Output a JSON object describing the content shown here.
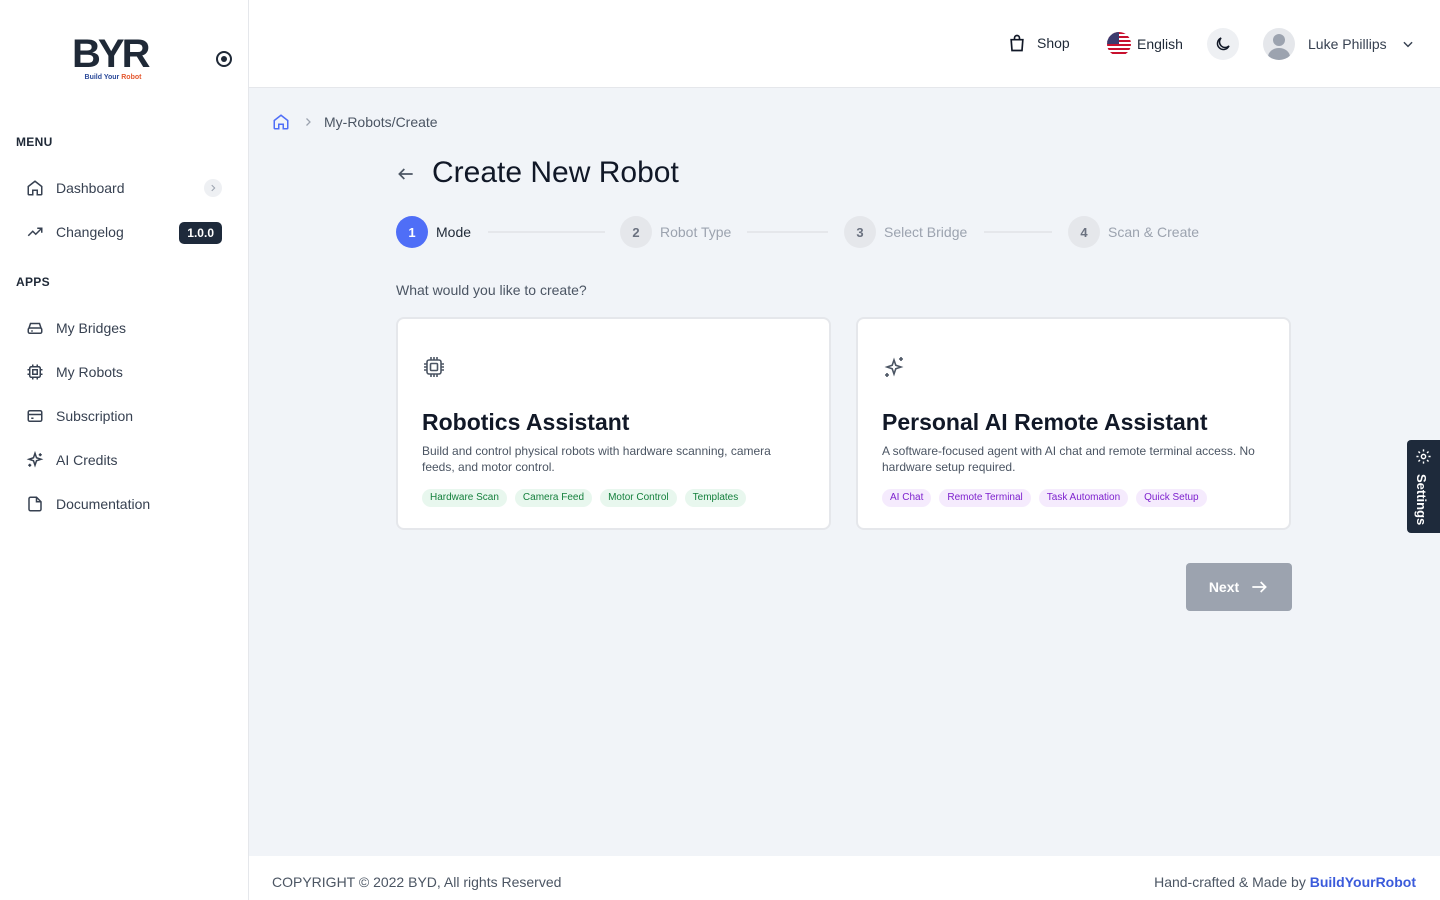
{
  "brand": {
    "logo_letters": "BYR",
    "logo_tagline_a": "Build Your",
    "logo_tagline_b": "Robot"
  },
  "sidebar": {
    "menu_label": "MENU",
    "apps_label": "APPS",
    "menu_items": [
      {
        "label": "Dashboard",
        "icon": "home-icon"
      },
      {
        "label": "Changelog",
        "icon": "trending-icon",
        "badge": "1.0.0"
      }
    ],
    "app_items": [
      {
        "label": "My Bridges",
        "icon": "server-icon"
      },
      {
        "label": "My Robots",
        "icon": "chip-icon"
      },
      {
        "label": "Subscription",
        "icon": "credit-card-icon"
      },
      {
        "label": "AI Credits",
        "icon": "sparkles-icon"
      },
      {
        "label": "Documentation",
        "icon": "file-icon"
      }
    ]
  },
  "header": {
    "shop_label": "Shop",
    "language_label": "English",
    "user_name": "Luke Phillips"
  },
  "breadcrumb": {
    "path": "My-Robots/Create"
  },
  "page": {
    "title": "Create New Robot",
    "prompt": "What would you like to create?"
  },
  "stepper": {
    "steps": [
      {
        "number": "1",
        "label": "Mode",
        "active": true
      },
      {
        "number": "2",
        "label": "Robot Type",
        "active": false
      },
      {
        "number": "3",
        "label": "Select Bridge",
        "active": false
      },
      {
        "number": "4",
        "label": "Scan & Create",
        "active": false
      }
    ]
  },
  "cards": [
    {
      "title": "Robotics Assistant",
      "description": "Build and control physical robots with hardware scanning, camera feeds, and motor control.",
      "icon": "chip-icon",
      "tags": [
        "Hardware Scan",
        "Camera Feed",
        "Motor Control",
        "Templates"
      ]
    },
    {
      "title": "Personal AI Remote Assistant",
      "description": "A software-focused agent with AI chat and remote terminal access. No hardware setup required.",
      "icon": "sparkles-icon",
      "tags": [
        "AI Chat",
        "Remote Terminal",
        "Task Automation",
        "Quick Setup"
      ]
    }
  ],
  "actions": {
    "next_label": "Next"
  },
  "settings_tab": {
    "label": "Settings"
  },
  "footer": {
    "copyright": "COPYRIGHT © 2022 BYD, All rights Reserved",
    "made_by_prefix": "Hand-crafted & Made by",
    "made_by_brand": "BuildYourRobot"
  },
  "colors": {
    "primary": "#4f6ef7",
    "sidebar_badge": "#1e2a3b",
    "next_disabled": "#9ca3af",
    "tag_green_bg": "#e8f7ee",
    "tag_purple_bg": "#f5ebfd"
  }
}
